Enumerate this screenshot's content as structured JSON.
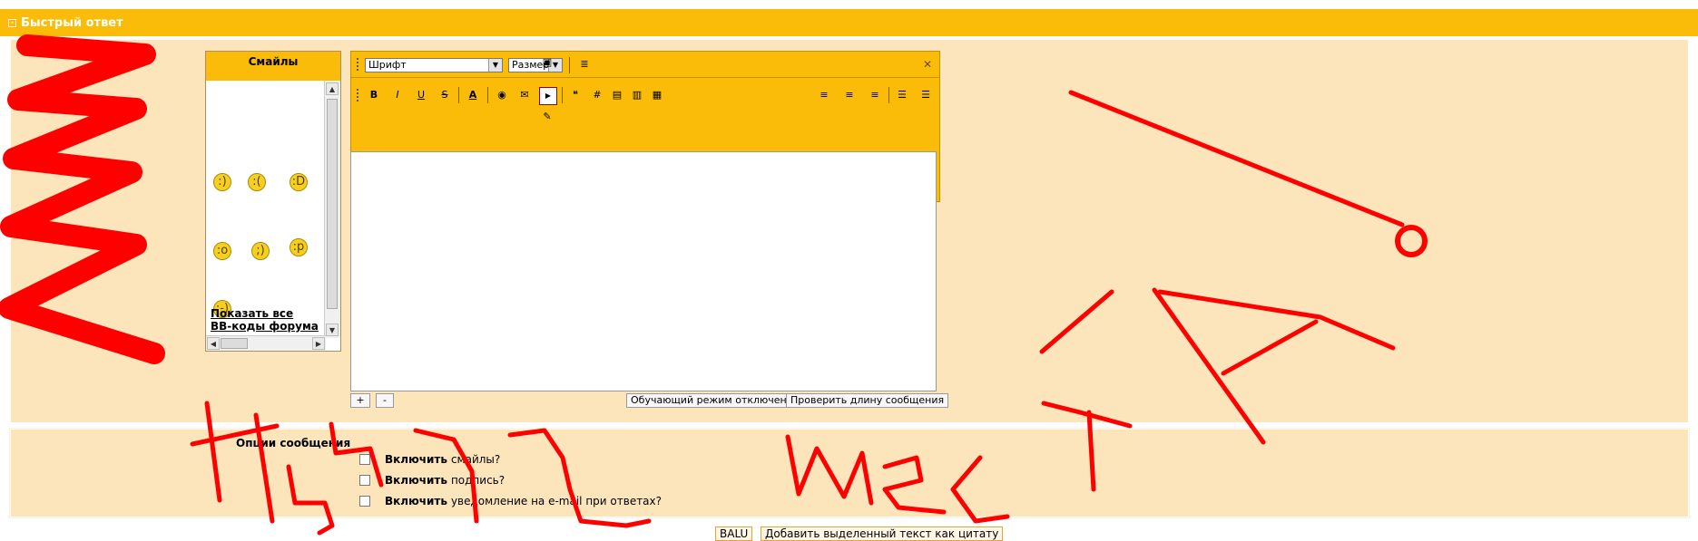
{
  "header": {
    "title": "Быстрый ответ"
  },
  "smilies": {
    "title": "Смайлы",
    "items": [
      ":)",
      ":(",
      ":D",
      ":o",
      ";)",
      ":p",
      ":-)"
    ],
    "show_all_line1": "Показать все",
    "show_all_line2": "BB-коды форума"
  },
  "editor": {
    "font_select": "Шрифт",
    "size_select": "Размер",
    "toolbar": [
      "B",
      "I",
      "U",
      "S"
    ],
    "resize_plus": "+",
    "resize_minus": "-",
    "tutorial_button": "Обучающий режим отключен",
    "check_length_button": "Проверить длину сообщения"
  },
  "options": {
    "title": "Опции сообщения",
    "items": [
      {
        "bold": "Включить",
        "text": "смайлы?"
      },
      {
        "bold": "Включить",
        "text": "подпись?"
      },
      {
        "bold": "Включить",
        "text": "уведомление на e-mail при ответах?"
      }
    ]
  },
  "bottom": {
    "user_button": "BALU",
    "quote_button": "Добавить выделенный текст как цитату"
  },
  "colors": {
    "accent": "#fbbc09",
    "panel": "#fde5bb",
    "annotation": "#ff0000"
  }
}
